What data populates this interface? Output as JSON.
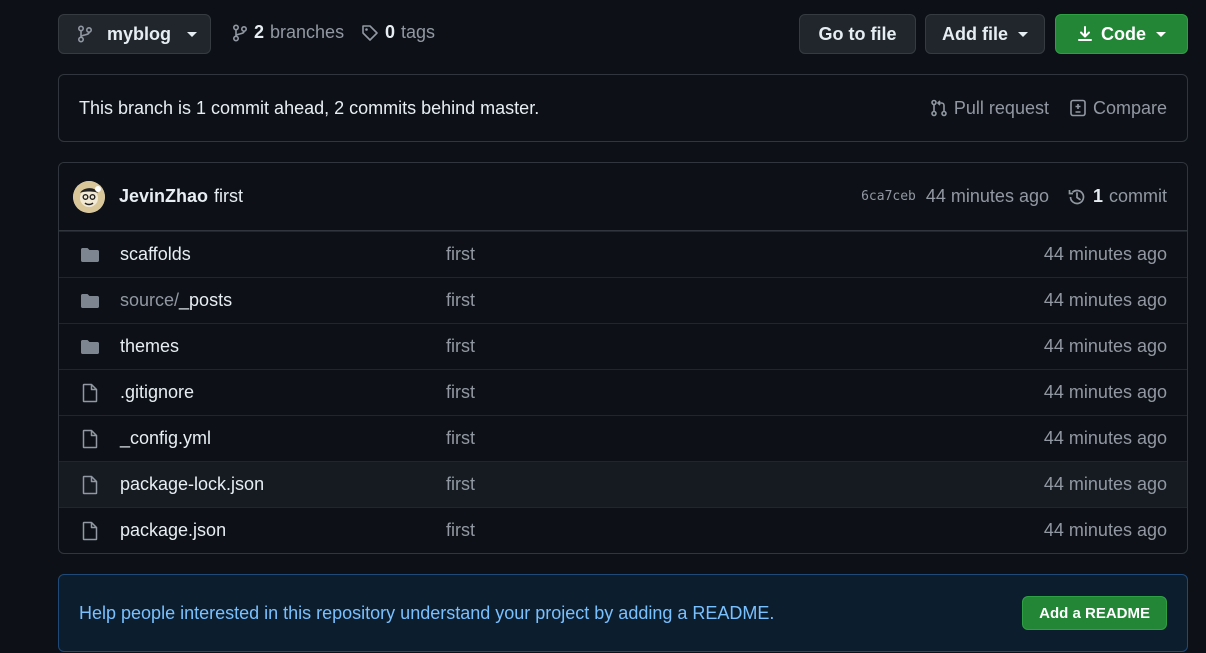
{
  "toolbar": {
    "branch_name": "myblog",
    "branches_count": "2",
    "branches_label": "branches",
    "tags_count": "0",
    "tags_label": "tags",
    "go_to_file_label": "Go to file",
    "add_file_label": "Add file",
    "code_label": "Code"
  },
  "ahead_bar": {
    "text": "This branch is 1 commit ahead, 2 commits behind master.",
    "pull_request_label": "Pull request",
    "compare_label": "Compare"
  },
  "latest_commit": {
    "author": "JevinZhao",
    "message": "first",
    "sha": "6ca7ceb",
    "age": "44 minutes ago",
    "commit_count": "1",
    "commit_label": "commit"
  },
  "files": [
    {
      "prefix": "",
      "name": "scaffolds",
      "type": "dir",
      "message": "first",
      "age": "44 minutes ago"
    },
    {
      "prefix": "source/",
      "name": "_posts",
      "type": "dir",
      "message": "first",
      "age": "44 minutes ago"
    },
    {
      "prefix": "",
      "name": "themes",
      "type": "dir",
      "message": "first",
      "age": "44 minutes ago"
    },
    {
      "prefix": "",
      "name": ".gitignore",
      "type": "file",
      "message": "first",
      "age": "44 minutes ago"
    },
    {
      "prefix": "",
      "name": "_config.yml",
      "type": "file",
      "message": "first",
      "age": "44 minutes ago"
    },
    {
      "prefix": "",
      "name": "package-lock.json",
      "type": "file",
      "message": "first",
      "age": "44 minutes ago"
    },
    {
      "prefix": "",
      "name": "package.json",
      "type": "file",
      "message": "first",
      "age": "44 minutes ago"
    }
  ],
  "readme_banner": {
    "text": "Help people interested in this repository understand your project by adding a README.",
    "button_label": "Add a README"
  },
  "colors": {
    "background": "#0d1117",
    "accent_green": "#238636",
    "link_blue": "#79c0ff",
    "muted": "#9198a1"
  }
}
